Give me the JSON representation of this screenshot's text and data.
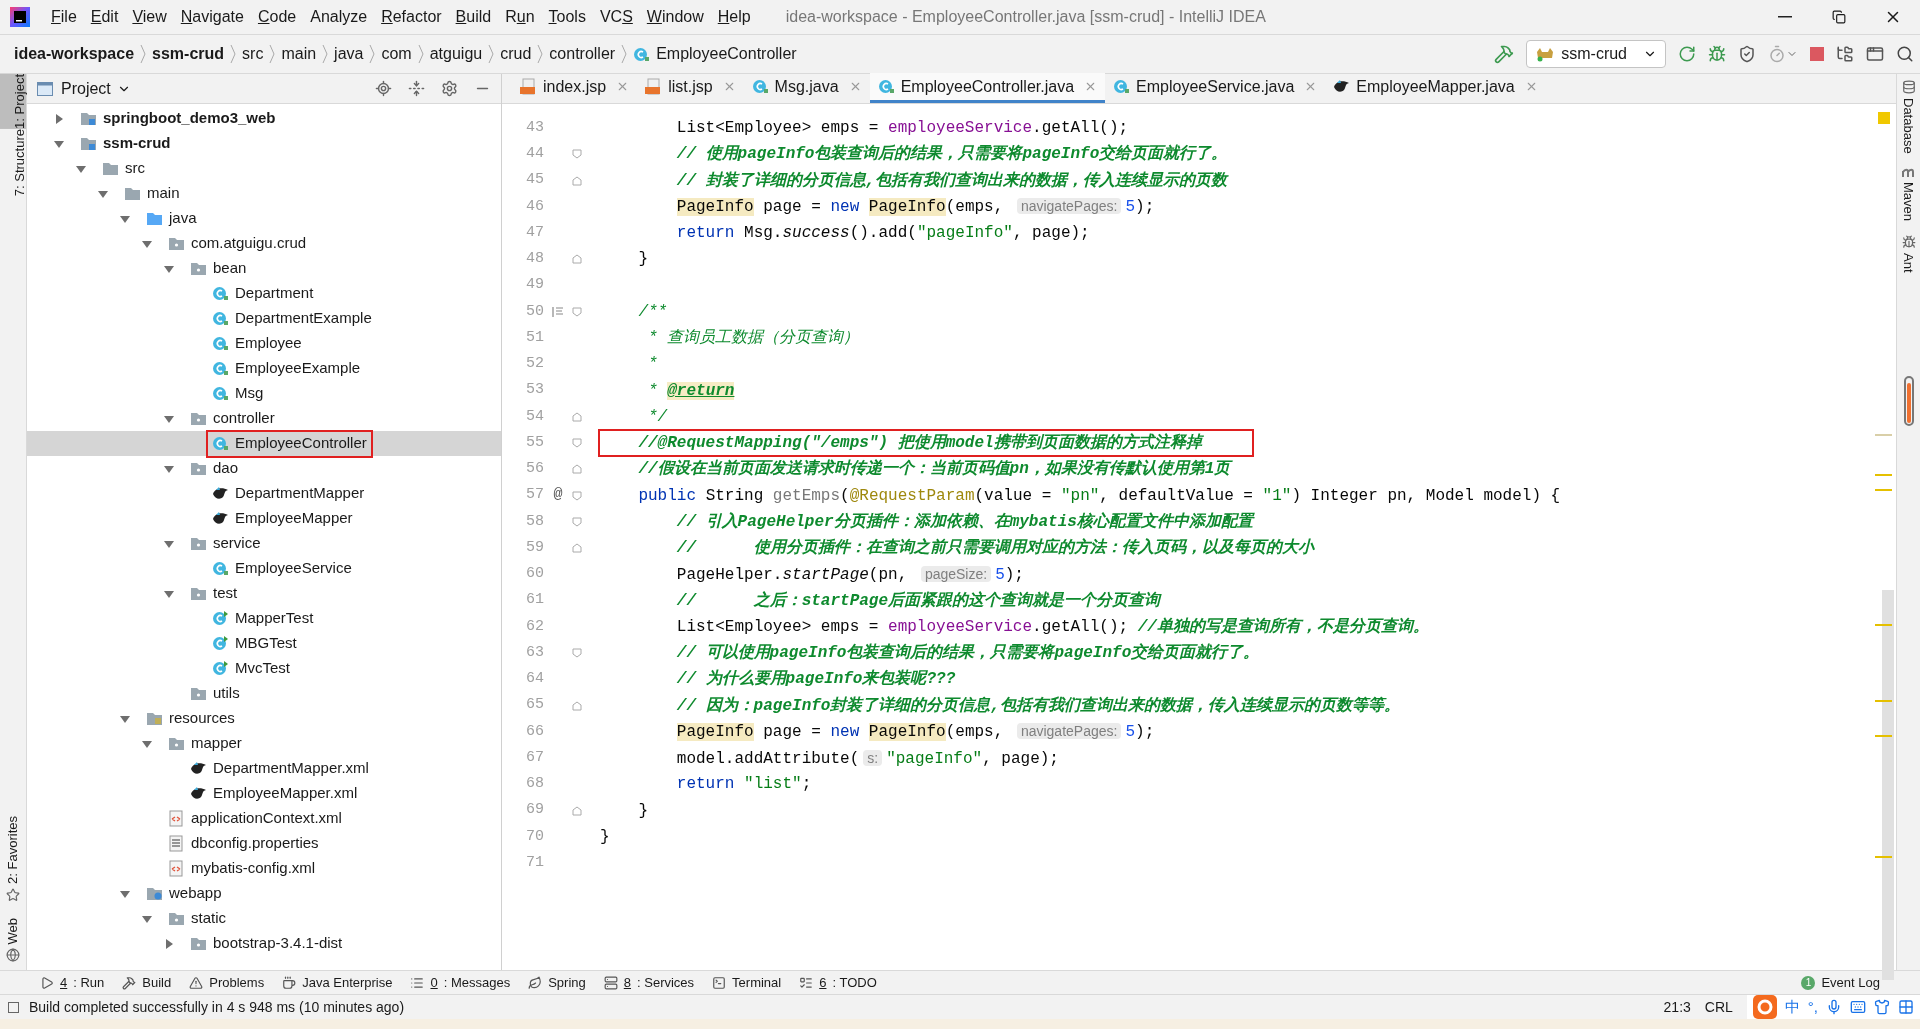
{
  "window": {
    "title": "idea-workspace - EmployeeController.java [ssm-crud] - IntelliJ IDEA"
  },
  "menu": [
    {
      "key": "F",
      "post": "ile"
    },
    {
      "key": "E",
      "post": "dit"
    },
    {
      "key": "V",
      "post": "iew"
    },
    {
      "key": "N",
      "post": "avigate"
    },
    {
      "key": "C",
      "post": "ode"
    },
    {
      "pre": "Analyze"
    },
    {
      "key": "R",
      "post": "efactor"
    },
    {
      "key": "B",
      "post": "uild"
    },
    {
      "pre": "R",
      "key": "u",
      "post": "n"
    },
    {
      "key": "T",
      "post": "ools"
    },
    {
      "pre": "VC",
      "key": "S"
    },
    {
      "key": "W",
      "post": "indow"
    },
    {
      "key": "H",
      "post": "elp"
    }
  ],
  "breadcrumbs": [
    {
      "label": "idea-workspace",
      "kind": "bold"
    },
    {
      "label": "ssm-crud",
      "kind": "bold"
    },
    {
      "label": "src",
      "kind": "plain"
    },
    {
      "label": "main",
      "kind": "plain"
    },
    {
      "label": "java",
      "kind": "plain"
    },
    {
      "label": "com",
      "kind": "plain"
    },
    {
      "label": "atguigu",
      "kind": "plain"
    },
    {
      "label": "crud",
      "kind": "plain"
    },
    {
      "label": "controller",
      "kind": "plain"
    },
    {
      "label": "EmployeeController",
      "kind": "class"
    }
  ],
  "run_config": "ssm-crud",
  "left_strip": {
    "top": [
      {
        "label": "1: Project",
        "selected": true
      },
      {
        "label": "7: Structure",
        "selected": false
      }
    ],
    "bottom": [
      {
        "label": "2: Favorites",
        "kind": "star"
      },
      {
        "label": "Web",
        "kind": "globe"
      }
    ]
  },
  "right_strip": [
    {
      "label": "Database",
      "kind": "database"
    },
    {
      "label": "Maven",
      "kind": "maven"
    },
    {
      "label": "Ant",
      "kind": "ant"
    }
  ],
  "project": {
    "title": "Project",
    "tree": [
      {
        "label": "springboot_demo3_web",
        "kind": "module",
        "bold": true,
        "expanded": false,
        "selected": false,
        "boxed": false
      },
      {
        "label": "ssm-crud",
        "kind": "module",
        "bold": true,
        "expanded": true,
        "selected": false,
        "boxed": false,
        "children": [
          {
            "label": "src",
            "kind": "folder",
            "expanded": true,
            "selected": false,
            "boxed": false,
            "children": [
              {
                "label": "main",
                "kind": "folder",
                "expanded": true,
                "selected": false,
                "boxed": false,
                "children": [
                  {
                    "label": "java",
                    "kind": "source",
                    "expanded": true,
                    "selected": false,
                    "boxed": false,
                    "children": [
                      {
                        "label": "com.atguigu.crud",
                        "kind": "package",
                        "expanded": true,
                        "selected": false,
                        "boxed": false,
                        "children": [
                          {
                            "label": "bean",
                            "kind": "package",
                            "expanded": true,
                            "selected": false,
                            "boxed": false,
                            "children": [
                              {
                                "label": "Department",
                                "kind": "class",
                                "selected": false,
                                "boxed": false
                              },
                              {
                                "label": "DepartmentExample",
                                "kind": "class",
                                "selected": false,
                                "boxed": false
                              },
                              {
                                "label": "Employee",
                                "kind": "class",
                                "selected": false,
                                "boxed": false
                              },
                              {
                                "label": "EmployeeExample",
                                "kind": "class",
                                "selected": false,
                                "boxed": false
                              },
                              {
                                "label": "Msg",
                                "kind": "class",
                                "selected": false,
                                "boxed": false
                              }
                            ]
                          },
                          {
                            "label": "controller",
                            "kind": "package",
                            "expanded": true,
                            "selected": false,
                            "boxed": false,
                            "children": [
                              {
                                "label": "EmployeeController",
                                "kind": "class",
                                "selected": true,
                                "boxed": true
                              }
                            ]
                          },
                          {
                            "label": "dao",
                            "kind": "package",
                            "expanded": true,
                            "selected": false,
                            "boxed": false,
                            "children": [
                              {
                                "label": "DepartmentMapper",
                                "kind": "mapper",
                                "selected": false,
                                "boxed": false
                              },
                              {
                                "label": "EmployeeMapper",
                                "kind": "mapper",
                                "selected": false,
                                "boxed": false
                              }
                            ]
                          },
                          {
                            "label": "service",
                            "kind": "package",
                            "expanded": true,
                            "selected": false,
                            "boxed": false,
                            "children": [
                              {
                                "label": "EmployeeService",
                                "kind": "class",
                                "selected": false,
                                "boxed": false
                              }
                            ]
                          },
                          {
                            "label": "test",
                            "kind": "package",
                            "expanded": true,
                            "selected": false,
                            "boxed": false,
                            "children": [
                              {
                                "label": "MapperTest",
                                "kind": "test",
                                "selected": false,
                                "boxed": false
                              },
                              {
                                "label": "MBGTest",
                                "kind": "test",
                                "selected": false,
                                "boxed": false
                              },
                              {
                                "label": "MvcTest",
                                "kind": "test",
                                "selected": false,
                                "boxed": false
                              }
                            ]
                          },
                          {
                            "label": "utils",
                            "kind": "package",
                            "selected": false,
                            "boxed": false
                          }
                        ]
                      }
                    ]
                  },
                  {
                    "label": "resources",
                    "kind": "resources",
                    "expanded": true,
                    "selected": false,
                    "boxed": false,
                    "children": [
                      {
                        "label": "mapper",
                        "kind": "package",
                        "expanded": true,
                        "selected": false,
                        "boxed": false,
                        "children": [
                          {
                            "label": "DepartmentMapper.xml",
                            "kind": "mapper",
                            "selected": false,
                            "boxed": false
                          },
                          {
                            "label": "EmployeeMapper.xml",
                            "kind": "mapper",
                            "selected": false,
                            "boxed": false
                          }
                        ]
                      },
                      {
                        "label": "applicationContext.xml",
                        "kind": "xml",
                        "selected": false,
                        "boxed": false
                      },
                      {
                        "label": "dbconfig.properties",
                        "kind": "properties",
                        "selected": false,
                        "boxed": false
                      },
                      {
                        "label": "mybatis-config.xml",
                        "kind": "xml",
                        "selected": false,
                        "boxed": false
                      }
                    ]
                  },
                  {
                    "label": "webapp",
                    "kind": "web",
                    "expanded": true,
                    "selected": false,
                    "boxed": false,
                    "children": [
                      {
                        "label": "static",
                        "kind": "package",
                        "expanded": true,
                        "selected": false,
                        "boxed": false,
                        "children": [
                          {
                            "label": "bootstrap-3.4.1-dist",
                            "kind": "package",
                            "expanded": false,
                            "selected": false,
                            "boxed": false
                          }
                        ]
                      }
                    ]
                  }
                ]
              }
            ]
          }
        ]
      }
    ]
  },
  "tabs": [
    {
      "label": "index.jsp",
      "kind": "jsp",
      "selected": false
    },
    {
      "label": "list.jsp",
      "kind": "jsp",
      "selected": false
    },
    {
      "label": "Msg.java",
      "kind": "class",
      "selected": false
    },
    {
      "label": "EmployeeController.java",
      "kind": "class",
      "selected": true
    },
    {
      "label": "EmployeeService.java",
      "kind": "class",
      "selected": false
    },
    {
      "label": "EmployeeMapper.java",
      "kind": "mapper",
      "selected": false
    }
  ],
  "code": [
    {
      "n": "43",
      "boxed": false,
      "fold_start": false,
      "fold_end": false,
      "tokens": [
        {
          "kind": "plain",
          "t": "        List<Employee> emps = "
        },
        {
          "kind": "field",
          "t": "employeeService"
        },
        {
          "kind": "plain",
          "t": ".getAll();"
        }
      ]
    },
    {
      "n": "44",
      "boxed": false,
      "fold_start": true,
      "fold_end": false,
      "tokens": [
        {
          "kind": "comment",
          "t": "        // 使用pageInfo包装查询后的结果，只需要将pageInfo交给页面就行了。"
        }
      ]
    },
    {
      "n": "45",
      "boxed": false,
      "fold_start": false,
      "fold_end": true,
      "tokens": [
        {
          "kind": "comment",
          "t": "        // 封装了详细的分页信息,包括有我们查询出来的数据，传入连续显示的页数"
        }
      ]
    },
    {
      "n": "46",
      "boxed": false,
      "fold_start": false,
      "fold_end": false,
      "tokens": [
        {
          "kind": "hl",
          "t": "        PageInfo"
        },
        {
          "kind": "plain",
          "t": " page = "
        },
        {
          "kind": "kw",
          "t": "new "
        },
        {
          "kind": "hl",
          "t": "PageInfo"
        },
        {
          "kind": "plain",
          "t": "(emps, "
        },
        {
          "kind": "hint",
          "t": "navigatePages:"
        },
        {
          "kind": "num",
          "t": "5"
        },
        {
          "kind": "plain",
          "t": ");"
        }
      ]
    },
    {
      "n": "47",
      "boxed": false,
      "fold_start": false,
      "fold_end": false,
      "tokens": [
        {
          "kind": "kw",
          "t": "        return"
        },
        {
          "kind": "plain",
          "t": " Msg."
        },
        {
          "kind": "italic",
          "t": "success"
        },
        {
          "kind": "plain",
          "t": "().add("
        },
        {
          "kind": "str",
          "t": "\"pageInfo\""
        },
        {
          "kind": "plain",
          "t": ", page);"
        }
      ]
    },
    {
      "n": "48",
      "boxed": false,
      "fold_start": false,
      "fold_end": true,
      "tokens": [
        {
          "kind": "plain",
          "t": "    }"
        }
      ]
    },
    {
      "n": "49",
      "fold_start": false,
      "fold_end": false
    },
    {
      "n": "50",
      "boxed": false,
      "fold_start": true,
      "fold_end": false,
      "doc_icon": true,
      "tokens": [
        {
          "kind": "doc",
          "t": "    /**"
        }
      ]
    },
    {
      "n": "51",
      "boxed": false,
      "fold_start": false,
      "fold_end": false,
      "tokens": [
        {
          "kind": "doc",
          "t": "     * 查询员工数据（分页查询）"
        }
      ]
    },
    {
      "n": "52",
      "boxed": false,
      "fold_start": false,
      "fold_end": false,
      "tokens": [
        {
          "kind": "doc",
          "t": "     *"
        }
      ]
    },
    {
      "n": "53",
      "boxed": false,
      "fold_start": false,
      "fold_end": false,
      "tokens": [
        {
          "kind": "doc",
          "t": "     * "
        },
        {
          "kind": "doctag",
          "t": "@return"
        }
      ]
    },
    {
      "n": "54",
      "boxed": false,
      "fold_start": false,
      "fold_end": true,
      "tokens": [
        {
          "kind": "doc",
          "t": "     */"
        }
      ]
    },
    {
      "n": "55",
      "boxed": true,
      "fold_start": true,
      "fold_end": false,
      "tokens": [
        {
          "kind": "comment",
          "t": "    //@RequestMapping(\"/emps\") 把使用model携带到页面数据的方式注释掉"
        }
      ]
    },
    {
      "n": "56",
      "boxed": false,
      "fold_start": false,
      "fold_end": true,
      "tokens": [
        {
          "kind": "comment",
          "t": "    //假设在当前页面发送请求时传递一个：当前页码值pn，如果没有传默认使用第1页"
        }
      ]
    },
    {
      "n": "57",
      "boxed": false,
      "fold_start": true,
      "fold_end": false,
      "gutter_text": "@",
      "tokens": [
        {
          "kind": "kw",
          "t": "    public"
        },
        {
          "kind": "plain",
          "t": " String "
        },
        {
          "kind": "unused",
          "t": "getEmps"
        },
        {
          "kind": "plain",
          "t": "("
        },
        {
          "kind": "ann",
          "t": "@RequestParam"
        },
        {
          "kind": "plain",
          "t": "(value = "
        },
        {
          "kind": "str",
          "t": "\"pn\""
        },
        {
          "kind": "plain",
          "t": ", defaultValue = "
        },
        {
          "kind": "str",
          "t": "\"1\""
        },
        {
          "kind": "plain",
          "t": ") Integer pn, Model model) {"
        }
      ]
    },
    {
      "n": "58",
      "boxed": false,
      "fold_start": true,
      "fold_end": false,
      "tokens": [
        {
          "kind": "comment",
          "t": "        // 引入PageHelper分页插件：添加依赖、在mybatis核心配置文件中添加配置"
        }
      ]
    },
    {
      "n": "59",
      "boxed": false,
      "fold_start": false,
      "fold_end": true,
      "tokens": [
        {
          "kind": "comment",
          "t": "        //      使用分页插件：在查询之前只需要调用对应的方法：传入页码，以及每页的大小"
        }
      ]
    },
    {
      "n": "60",
      "boxed": false,
      "fold_start": false,
      "fold_end": false,
      "tokens": [
        {
          "kind": "plain",
          "t": "        PageHelper."
        },
        {
          "kind": "italic",
          "t": "startPage"
        },
        {
          "kind": "plain",
          "t": "(pn, "
        },
        {
          "kind": "hint",
          "t": "pageSize:"
        },
        {
          "kind": "num",
          "t": "5"
        },
        {
          "kind": "plain",
          "t": ");"
        }
      ]
    },
    {
      "n": "61",
      "boxed": false,
      "fold_start": false,
      "fold_end": false,
      "tokens": [
        {
          "kind": "comment",
          "t": "        //      之后：startPage后面紧跟的这个查询就是一个分页查询"
        }
      ]
    },
    {
      "n": "62",
      "boxed": false,
      "fold_start": false,
      "fold_end": false,
      "tokens": [
        {
          "kind": "plain",
          "t": "        List<Employee> emps = "
        },
        {
          "kind": "field",
          "t": "employeeService"
        },
        {
          "kind": "plain",
          "t": ".getAll(); "
        },
        {
          "kind": "comment",
          "t": "//单独的写是查询所有，不是分页查询。"
        }
      ]
    },
    {
      "n": "63",
      "boxed": false,
      "fold_start": true,
      "fold_end": false,
      "tokens": [
        {
          "kind": "comment",
          "t": "        // 可以使用pageInfo包装查询后的结果，只需要将pageInfo交给页面就行了。"
        }
      ]
    },
    {
      "n": "64",
      "boxed": false,
      "fold_start": false,
      "fold_end": false,
      "tokens": [
        {
          "kind": "comment",
          "t": "        // 为什么要用pageInfo来包装呢???"
        }
      ]
    },
    {
      "n": "65",
      "boxed": false,
      "fold_start": false,
      "fold_end": true,
      "tokens": [
        {
          "kind": "comment",
          "t": "        // 因为：pageInfo封装了详细的分页信息,包括有我们查询出来的数据，传入连续显示的页数等等。"
        }
      ]
    },
    {
      "n": "66",
      "boxed": false,
      "fold_start": false,
      "fold_end": false,
      "tokens": [
        {
          "kind": "hl",
          "t": "        PageInfo"
        },
        {
          "kind": "plain",
          "t": " page = "
        },
        {
          "kind": "kw",
          "t": "new "
        },
        {
          "kind": "hl",
          "t": "PageInfo"
        },
        {
          "kind": "plain",
          "t": "(emps, "
        },
        {
          "kind": "hint",
          "t": "navigatePages:"
        },
        {
          "kind": "num",
          "t": "5"
        },
        {
          "kind": "plain",
          "t": ");"
        }
      ]
    },
    {
      "n": "67",
      "boxed": false,
      "fold_start": false,
      "fold_end": false,
      "tokens": [
        {
          "kind": "plain",
          "t": "        model.addAttribute("
        },
        {
          "kind": "hint",
          "t": "s:"
        },
        {
          "kind": "str",
          "t": "\"pageInfo\""
        },
        {
          "kind": "plain",
          "t": ", page);"
        }
      ]
    },
    {
      "n": "68",
      "boxed": false,
      "fold_start": false,
      "fold_end": false,
      "tokens": [
        {
          "kind": "kw",
          "t": "        return"
        },
        {
          "kind": "str",
          "t": " \"list\""
        },
        {
          "kind": "plain",
          "t": ";"
        }
      ]
    },
    {
      "n": "69",
      "boxed": false,
      "fold_start": false,
      "fold_end": true,
      "tokens": [
        {
          "kind": "plain",
          "t": "    }"
        }
      ]
    },
    {
      "n": "70",
      "boxed": false,
      "fold_start": false,
      "fold_end": false,
      "tokens": [
        {
          "kind": "plain",
          "t": "}"
        }
      ]
    },
    {
      "n": "71",
      "fold_start": false,
      "fold_end": false
    }
  ],
  "tool_buttons": [
    {
      "key": "4",
      "post": ": Run",
      "kind": "run"
    },
    {
      "pre": "Build",
      "kind": "build"
    },
    {
      "pre": "Problems",
      "kind": "problems"
    },
    {
      "pre": "Java Enterprise",
      "kind": "enterprise"
    },
    {
      "key": "0",
      "post": ": Messages",
      "kind": "messages"
    },
    {
      "pre": "Spring",
      "kind": "spring"
    },
    {
      "key": "8",
      "post": ": Services",
      "kind": "services"
    },
    {
      "pre": "Terminal",
      "kind": "terminal"
    },
    {
      "key": "6",
      "post": ": TODO",
      "kind": "todo"
    }
  ],
  "event_log": {
    "label": "Event Log",
    "badge": "1"
  },
  "status": {
    "message": "Build completed successfully in 4 s 948 ms (10 minutes ago)",
    "position": "21:3",
    "line_separator": "CRL"
  },
  "ime": {
    "mode": "中",
    "punct": "°,"
  }
}
